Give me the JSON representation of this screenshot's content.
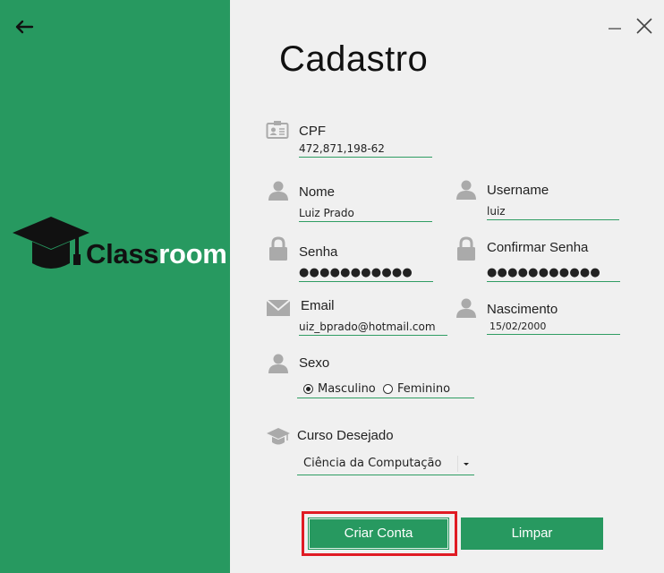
{
  "window": {
    "title": "Cadastro"
  },
  "brand": {
    "part1": "Class",
    "part2": "room"
  },
  "colors": {
    "accent": "#279960",
    "highlight": "#e01b24",
    "background": "#f0f0f0"
  },
  "icons": {
    "back": "arrow-left-icon",
    "minimize": "minimize-icon",
    "close": "close-icon",
    "cpf": "id-card-icon",
    "user": "user-icon",
    "lock": "lock-icon",
    "email": "envelope-icon",
    "course": "graduation-cap-icon"
  },
  "form": {
    "cpf": {
      "label": "CPF",
      "value": "472,871,198-62"
    },
    "nome": {
      "label": "Nome",
      "value": "Luiz Prado"
    },
    "username": {
      "label": "Username",
      "value": "luiz"
    },
    "senha": {
      "label": "Senha",
      "value": "●●●●●●●●●●●"
    },
    "confirmar": {
      "label": "Confirmar Senha",
      "value": "●●●●●●●●●●●"
    },
    "email": {
      "label": "Email",
      "value": "uiz_bprado@hotmail.com"
    },
    "nascimento": {
      "label": "Nascimento",
      "value": "15/02/2000"
    },
    "sexo": {
      "label": "Sexo",
      "options": [
        {
          "label": "Masculino",
          "selected": true
        },
        {
          "label": "Feminino",
          "selected": false
        }
      ]
    },
    "curso": {
      "label": "Curso Desejado",
      "value": "Ciência da Computação"
    }
  },
  "buttons": {
    "criar": "Criar Conta",
    "limpar": "Limpar"
  }
}
